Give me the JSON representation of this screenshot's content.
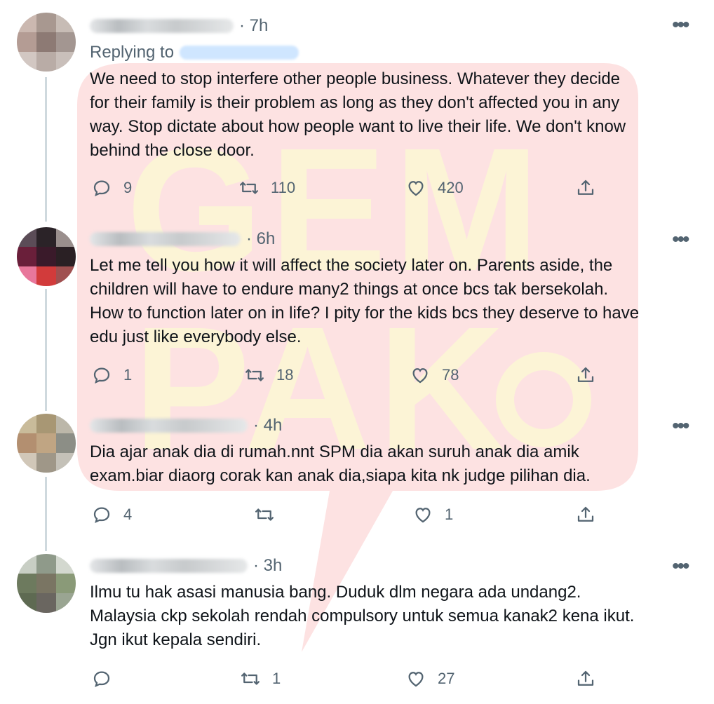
{
  "watermark": {
    "text_top": "GEM",
    "text_bottom": "PAK",
    "bg_color": "#fde3e3",
    "letter_color": "#fbf3d8"
  },
  "tweets": [
    {
      "time": "7h",
      "replying_to_label": "Replying to",
      "text": "We need to stop interfere other people business. Whatever they decide\nfor their family is their problem as long as they don't affected you in any\nway. Stop dictate about how people want to live their life. We don't know\nbehind the close door.",
      "replies": "9",
      "retweets": "110",
      "likes": "420",
      "avatar_colors": [
        "#cbb8b0",
        "#a89890",
        "#c7bcb5",
        "#b49c94",
        "#8d7a74",
        "#a39691",
        "#d2c7c2",
        "#b9aca6",
        "#c9bfba"
      ]
    },
    {
      "time": "6h",
      "text": "Let me tell you how it will affect the society later on. Parents aside, the\nchildren will have to endure many2 things at once bcs tak bersekolah.\nHow to function later on in life? I pity for the kids bcs they deserve to have\nedu just like everybody else.",
      "replies": "1",
      "retweets": "18",
      "likes": "78",
      "avatar_colors": [
        "#5b4c57",
        "#2b2328",
        "#9a8f8d",
        "#6a1f3a",
        "#3a1a2a",
        "#2a2024",
        "#e8779b",
        "#d23b3b",
        "#a05050"
      ]
    },
    {
      "time": "4h",
      "text": "Dia ajar anak dia di rumah.nnt SPM dia akan suruh anak dia amik\nexam.biar diaorg corak kan anak dia,siapa kita nk judge pilihan dia.",
      "replies": "4",
      "retweets": "",
      "likes": "1",
      "avatar_colors": [
        "#c9bb9a",
        "#a89774",
        "#bcb7a9",
        "#b38f70",
        "#c0a583",
        "#8c8e86",
        "#d1c7b8",
        "#9f9788",
        "#c4c1b8"
      ]
    },
    {
      "time": "3h",
      "text": "Ilmu tu hak asasi manusia bang. Duduk dlm negara ada undang2.\nMalaysia ckp sekolah rendah compulsory untuk semua kanak2 kena ikut.\nJgn ikut kepala sendiri.",
      "replies": "",
      "retweets": "1",
      "likes": "27",
      "avatar_colors": [
        "#c8cec4",
        "#8f9a8a",
        "#d3d8cf",
        "#6d7a5e",
        "#7a7563",
        "#8a9a78",
        "#5e6a52",
        "#6a6660",
        "#9aa592"
      ]
    }
  ],
  "icons": {
    "more": "more-dots-icon",
    "reply": "reply-icon",
    "retweet": "retweet-icon",
    "like": "heart-icon",
    "share": "share-icon"
  },
  "colors": {
    "secondary_text": "#536471",
    "primary_text": "#0f1419",
    "thread_line": "#cfd9de"
  }
}
